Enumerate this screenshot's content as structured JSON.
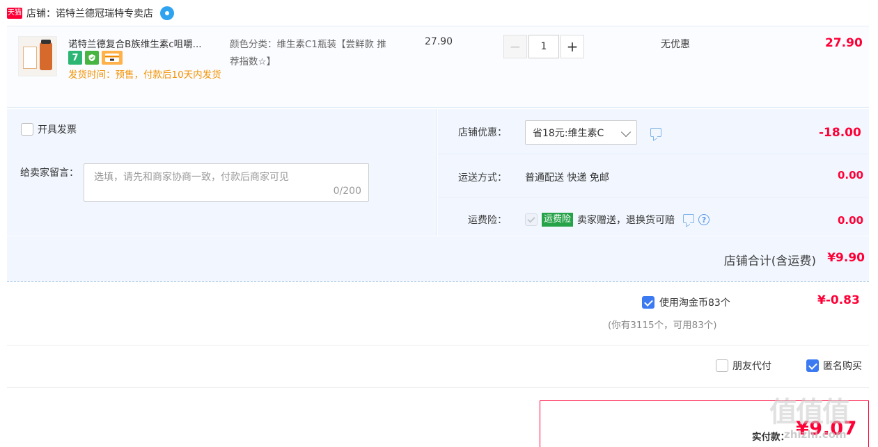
{
  "shop": {
    "badge": "天猫",
    "name": "店铺：诺特兰德冠瑞特专卖店"
  },
  "item": {
    "title": "诺特兰德复合B族维生素c咀嚼...",
    "ship_time": "发货时间：预售，付款后10天内发货",
    "sku": "颜色分类：维生素C1瓶装【尝鲜款 推荐指数☆】",
    "unit_price": "27.90",
    "quantity": "1",
    "minus_label": "−",
    "plus_label": "+",
    "promo": "无优惠",
    "total": "27.90",
    "service_seven": "7"
  },
  "options": {
    "invoice_label": "开具发票",
    "message_label": "给卖家留言：",
    "message_placeholder": "选填，请先和商家协商一致，付款后商家可见",
    "message_count": "0/200",
    "shop_coupon_label": "店铺优惠：",
    "shop_coupon_value": "省18元:维生素C",
    "shop_coupon_amount": "-18.00",
    "shipping_label": "运送方式：",
    "shipping_value": "普通配送 快递 免邮",
    "shipping_amount": "0.00",
    "insurance_label": "运费险：",
    "insurance_badge": "运费险",
    "insurance_text": "卖家赠送，退换货可赔",
    "insurance_amount": "0.00",
    "help_glyph": "?"
  },
  "subtotal": {
    "label": "店铺合计(含运费)",
    "value": "¥9.90"
  },
  "coins": {
    "label": "使用淘金币83个",
    "sub": "(你有3115个，可用83个)",
    "value": "¥-0.83"
  },
  "pay_options": {
    "friend_pay": "朋友代付",
    "anonymous": "匿名购买"
  },
  "final": {
    "label": "实付款：",
    "value": "¥9.07"
  },
  "watermark": {
    "glyphs": "值值值",
    "site": "zhizhi.com"
  }
}
